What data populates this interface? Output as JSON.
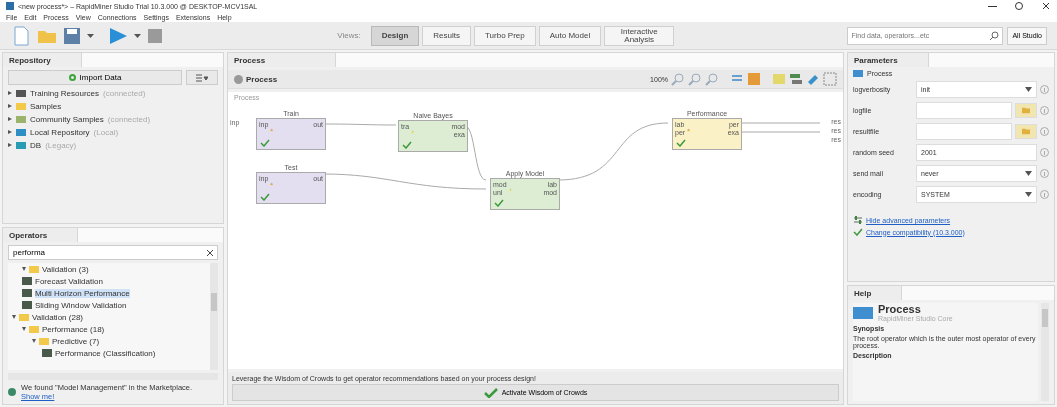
{
  "window": {
    "title": "<new process*> – RapidMiner Studio Trial 10.3.000 @ DESKTOP-MCV1SAL"
  },
  "menu": [
    "File",
    "Edit",
    "Process",
    "View",
    "Connections",
    "Settings",
    "Extensions",
    "Help"
  ],
  "views": {
    "label": "Views:",
    "tabs": [
      {
        "label": "Design",
        "selected": true
      },
      {
        "label": "Results",
        "selected": false
      },
      {
        "label": "Turbo Prep",
        "selected": false
      },
      {
        "label": "Auto Model",
        "selected": false
      },
      {
        "label": "Interactive Analysis",
        "selected": false
      }
    ]
  },
  "search": {
    "placeholder": "Find data, operators...etc",
    "scope": "All Studio"
  },
  "repository": {
    "title": "Repository",
    "import_button": "Import Data",
    "items": [
      {
        "name": "Training Resources",
        "note": "(connected)",
        "kind": "training"
      },
      {
        "name": "Samples",
        "kind": "folder"
      },
      {
        "name": "Community Samples",
        "note": "(connected)",
        "kind": "community"
      },
      {
        "name": "Local Repository",
        "note": "(Local)",
        "kind": "local"
      },
      {
        "name": "DB",
        "note": "(Legacy)",
        "kind": "db"
      }
    ]
  },
  "operators": {
    "title": "Operators",
    "search_value": "performa",
    "tree": [
      {
        "name": "Validation (3)",
        "kind": "folder",
        "expanded": true,
        "selected": false,
        "children": [
          {
            "name": "Forecast Validation",
            "kind": "operator",
            "selected": false
          },
          {
            "name": "Multi Horizon Performance",
            "kind": "operator",
            "selected": true
          },
          {
            "name": "Sliding Window Validation",
            "kind": "operator",
            "selected": false
          }
        ]
      },
      {
        "name": "Validation (28)",
        "kind": "folder",
        "expanded": true,
        "selected": false,
        "children": [
          {
            "name": "Performance (18)",
            "kind": "folder",
            "expanded": true,
            "selected": false,
            "children": [
              {
                "name": "Predictive (7)",
                "kind": "folder",
                "expanded": true,
                "selected": false,
                "children": [
                  {
                    "name": "Performance (Classification)",
                    "kind": "operator",
                    "selected": false
                  }
                ]
              }
            ]
          }
        ]
      }
    ],
    "marketplace": {
      "text": "We found \"Model Management\" in the Marketplace.",
      "link": "Show me!"
    }
  },
  "process": {
    "tab": "Process",
    "breadcrumb": "Process",
    "zoom": "100%",
    "canvas_label": "Process",
    "nodes": [
      {
        "name": "Train",
        "kind": "retrieve",
        "in": [
          "inp"
        ],
        "out": [
          "out"
        ]
      },
      {
        "name": "Naive Bayes",
        "kind": "model",
        "in": [
          "tra"
        ],
        "out": [
          "mod",
          "exa"
        ]
      },
      {
        "name": "Test",
        "kind": "retrieve",
        "in": [
          "inp"
        ],
        "out": [
          "out"
        ]
      },
      {
        "name": "Apply Model",
        "kind": "model",
        "in": [
          "mod",
          "unl"
        ],
        "out": [
          "lab",
          "mod"
        ]
      },
      {
        "name": "Performance",
        "kind": "eval",
        "in": [
          "lab",
          "per"
        ],
        "out": [
          "per",
          "exa"
        ]
      }
    ],
    "process_ports_in": [
      "inp"
    ],
    "process_ports_out": [
      "res",
      "res",
      "res"
    ],
    "hint": "Leverage the Wisdom of Crowds to get operator recommendations based on your process design!",
    "activate_button": "Activate Wisdom of Crowds"
  },
  "parameters": {
    "title": "Parameters",
    "operator": "Process",
    "rows": [
      {
        "label": "logverbosity",
        "kind": "select",
        "value": "init"
      },
      {
        "label": "logfile",
        "kind": "file"
      },
      {
        "label": "resultfile",
        "kind": "file"
      },
      {
        "label": "random seed",
        "kind": "text",
        "value": "2001"
      },
      {
        "label": "send mail",
        "kind": "select",
        "value": "never"
      },
      {
        "label": "encoding",
        "kind": "select",
        "value": "SYSTEM"
      }
    ],
    "advanced_link": "Hide advanced parameters",
    "compat_link": "Change compatibility (10.3.000)"
  },
  "help": {
    "title": "Help",
    "operator": "Process",
    "group": "RapidMiner Studio Core",
    "synopsis_heading": "Synopsis",
    "synopsis": "The root operator which is the outer most operator of every process.",
    "description_heading": "Description"
  }
}
